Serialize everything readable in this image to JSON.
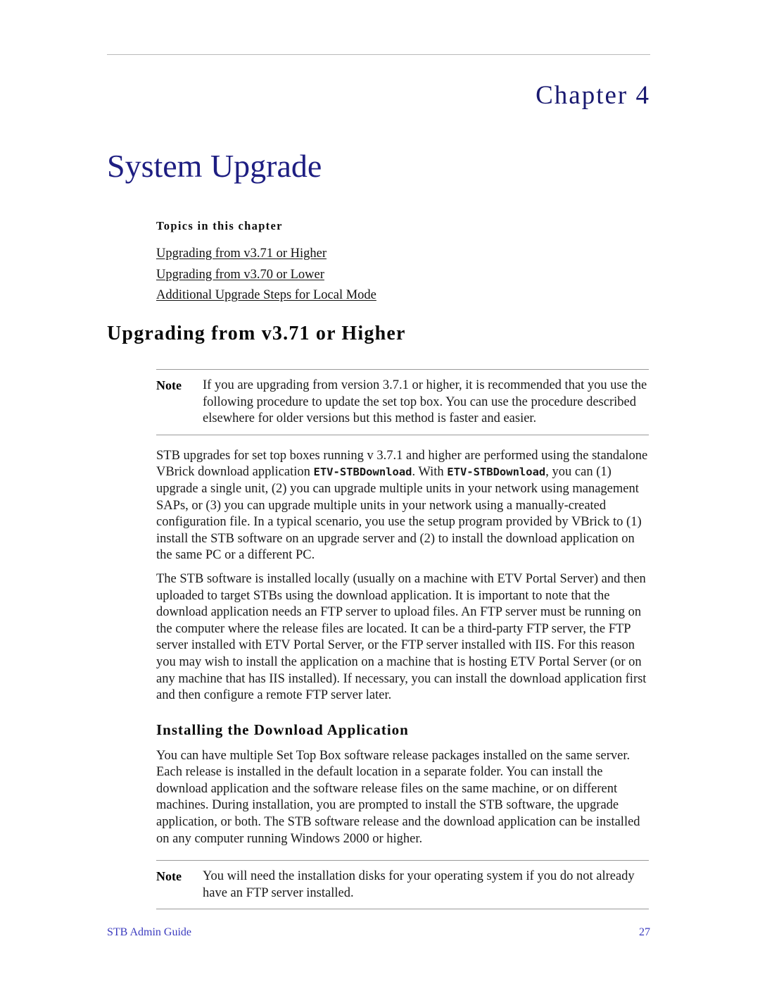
{
  "document": {
    "chapter_label": "Chapter  4",
    "chapter_title": "System Upgrade"
  },
  "topics": {
    "heading": "Topics in this chapter",
    "links": [
      "Upgrading from v3.71 or Higher",
      "Upgrading from v3.70 or Lower",
      "Additional Upgrade Steps for Local Mode"
    ]
  },
  "section": {
    "heading": "Upgrading from v3.71 or Higher"
  },
  "notes": {
    "first": {
      "label": "Note",
      "text": "If you are upgrading from version 3.7.1 or higher, it is recommended that you use the following procedure to update the set top box. You can use the procedure described elsewhere for older versions but this method is faster and easier."
    },
    "second": {
      "label": "Note",
      "text": "You will need the installation disks for your operating system if you do not already have an FTP server installed."
    }
  },
  "paragraphs": {
    "p1_part1": "STB upgrades for set top boxes running v 3.7.1 and higher are performed using the standalone VBrick download application ",
    "p1_code1": "ETV-STBDownload",
    "p1_part2": ". With ",
    "p1_code2": "ETV-STBDownload",
    "p1_part3": ", you can (1) upgrade a single unit, (2) you can upgrade multiple units in your network using management SAPs, or (3) you can upgrade multiple units in your network using a manually-created configuration file. In a typical scenario, you use the setup program provided by VBrick to (1) install the STB software on an upgrade server and (2) to install the download application on the same PC or a different PC.",
    "p2": "The STB software is installed locally (usually on a machine with ETV Portal Server) and then uploaded to target STBs using the download application. It is important to note that the download application needs an FTP server to upload files. An FTP server must be running on the computer where the release files are located. It can be a third-party FTP server, the FTP server installed with ETV Portal Server, or the FTP server installed with IIS. For this reason you may wish to install the application on a machine that is hosting ETV Portal Server (or on any machine that has IIS installed). If necessary, you can install the download application first and then configure a remote FTP server later.",
    "p3": "You can have multiple Set Top Box software release packages installed on the same server. Each release is installed in the default location in a separate folder. You can install the download application and the software release files on the same machine, or on different machines. During installation, you are prompted to install the STB software, the upgrade application, or both. The STB software release and the download application can be installed on any computer running Windows 2000 or higher."
  },
  "subsection": {
    "heading": "Installing the Download Application"
  },
  "footer": {
    "left": "STB Admin Guide",
    "right": "27"
  },
  "colors": {
    "heading_blue": "#191970",
    "title_blue": "#1e1e82",
    "footer_blue": "#3b3bbf",
    "rule_gray": "#9a9a9a",
    "header_rule_gray": "#b9b9b9"
  }
}
